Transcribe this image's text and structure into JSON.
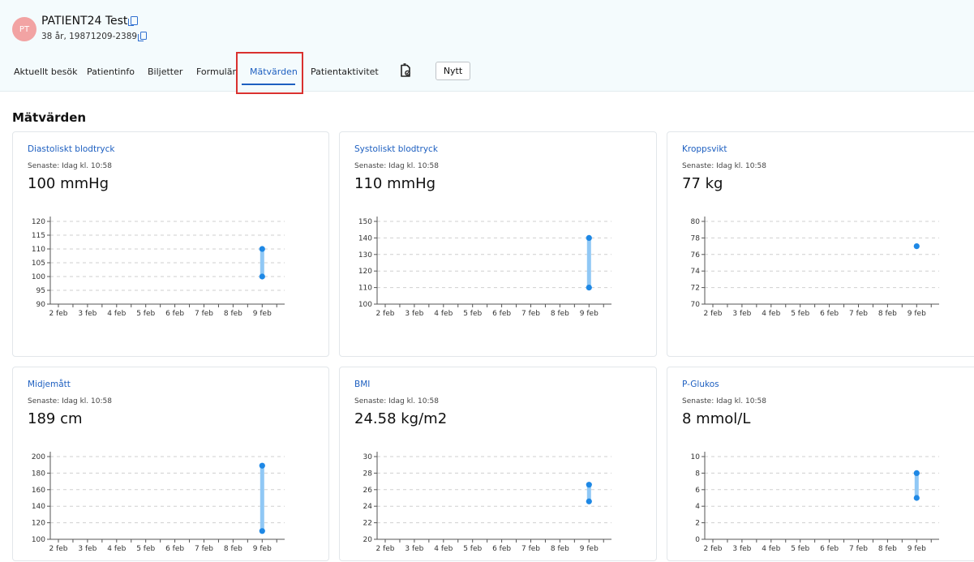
{
  "patient": {
    "initials": "PT",
    "name": "PATIENT24 Test",
    "meta": "38 år, 19871209-2389"
  },
  "tabs": [
    {
      "label": "Aktuellt besök"
    },
    {
      "label": "Patientinfo"
    },
    {
      "label": "Biljetter"
    },
    {
      "label": "Formulär"
    },
    {
      "label": "Mätvärden",
      "active": true
    },
    {
      "label": "Patientaktivitet"
    }
  ],
  "toolbar": {
    "new_label": "Nytt",
    "doc_icon": "clipboard-document-icon"
  },
  "section_title": "Mätvärden",
  "colors": {
    "accent": "#1d5fc0",
    "point": "#1e88e5",
    "range": "#90c8f5",
    "highlight": "#d9312f"
  },
  "cards": [
    {
      "title": "Diastoliskt blodtryck",
      "latest": "Senaste: Idag kl. 10:58",
      "value": "100 mmHg"
    },
    {
      "title": "Systoliskt blodtryck",
      "latest": "Senaste: Idag kl. 10:58",
      "value": "110 mmHg"
    },
    {
      "title": "Kroppsvikt",
      "latest": "Senaste: Idag kl. 10:58",
      "value": "77 kg"
    },
    {
      "title": "Midjemått",
      "latest": "Senaste: Idag kl. 10:58",
      "value": "189 cm"
    },
    {
      "title": "BMI",
      "latest": "Senaste: Idag kl. 10:58",
      "value": "24.58 kg/m2"
    },
    {
      "title": "P-Glukos",
      "latest": "Senaste: Idag kl. 10:58",
      "value": "8 mmol/L"
    }
  ],
  "chart_data": [
    {
      "type": "scatter",
      "x": [
        "2 feb",
        "3 feb",
        "4 feb",
        "5 feb",
        "6 feb",
        "7 feb",
        "8 feb",
        "9 feb"
      ],
      "yticks": [
        90,
        95,
        100,
        105,
        110,
        115,
        120
      ],
      "ylim": [
        90,
        120
      ],
      "points": [
        {
          "x": "9 feb",
          "y": 100
        },
        {
          "x": "9 feb",
          "y": 110
        }
      ],
      "grid": true
    },
    {
      "type": "scatter",
      "x": [
        "2 feb",
        "3 feb",
        "4 feb",
        "5 feb",
        "6 feb",
        "7 feb",
        "8 feb",
        "9 feb"
      ],
      "yticks": [
        100,
        110,
        120,
        130,
        140,
        150
      ],
      "ylim": [
        100,
        150
      ],
      "points": [
        {
          "x": "9 feb",
          "y": 110
        },
        {
          "x": "9 feb",
          "y": 140
        }
      ],
      "grid": true
    },
    {
      "type": "scatter",
      "x": [
        "2 feb",
        "3 feb",
        "4 feb",
        "5 feb",
        "6 feb",
        "7 feb",
        "8 feb",
        "9 feb"
      ],
      "yticks": [
        70,
        72,
        74,
        76,
        78,
        80
      ],
      "ylim": [
        70,
        80
      ],
      "points": [
        {
          "x": "9 feb",
          "y": 77
        }
      ],
      "grid": true
    },
    {
      "type": "scatter",
      "x": [
        "2 feb",
        "3 feb",
        "4 feb",
        "5 feb",
        "6 feb",
        "7 feb",
        "8 feb",
        "9 feb"
      ],
      "yticks": [
        100,
        120,
        140,
        160,
        180,
        200
      ],
      "ylim": [
        100,
        200
      ],
      "points": [
        {
          "x": "9 feb",
          "y": 110
        },
        {
          "x": "9 feb",
          "y": 189
        }
      ],
      "grid": true
    },
    {
      "type": "scatter",
      "x": [
        "2 feb",
        "3 feb",
        "4 feb",
        "5 feb",
        "6 feb",
        "7 feb",
        "8 feb",
        "9 feb"
      ],
      "yticks": [
        20,
        22,
        24,
        26,
        28,
        30
      ],
      "ylim": [
        20,
        30
      ],
      "points": [
        {
          "x": "9 feb",
          "y": 24.58
        },
        {
          "x": "9 feb",
          "y": 26.6
        }
      ],
      "grid": true
    },
    {
      "type": "scatter",
      "x": [
        "2 feb",
        "3 feb",
        "4 feb",
        "5 feb",
        "6 feb",
        "7 feb",
        "8 feb",
        "9 feb"
      ],
      "yticks": [
        0,
        2,
        4,
        6,
        8,
        10
      ],
      "ylim": [
        0,
        10
      ],
      "points": [
        {
          "x": "9 feb",
          "y": 5
        },
        {
          "x": "9 feb",
          "y": 8
        }
      ],
      "grid": true
    }
  ]
}
